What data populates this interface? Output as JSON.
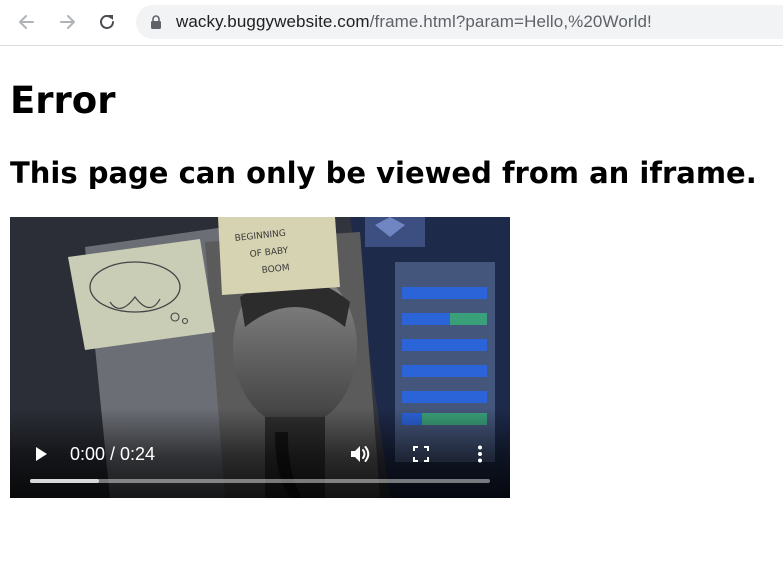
{
  "browser": {
    "url_host": "wacky.buggywebsite.com",
    "url_path": "/frame.html?param=Hello,%20World!",
    "icons": {
      "back": "arrow-left",
      "forward": "arrow-right",
      "reload": "reload",
      "lock": "lock"
    }
  },
  "page": {
    "heading": "Error",
    "subheading": "This page can only be viewed from an iframe."
  },
  "video": {
    "time_display": "0:00 / 0:24",
    "buffered_fraction": 0.15,
    "poster_notes": {
      "note_text": "BEGINNING OF BABY BOOM"
    },
    "controls_icons": [
      "play-icon",
      "volume-icon",
      "fullscreen-icon",
      "more-vert-icon"
    ]
  }
}
